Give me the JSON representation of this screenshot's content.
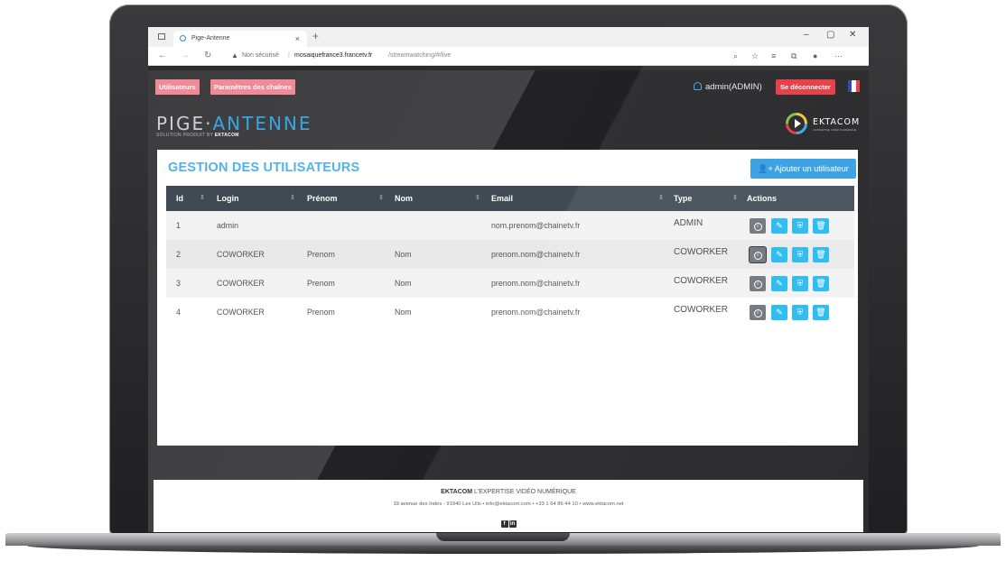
{
  "browser": {
    "tab_title": "Pige-Antenne",
    "tab_close": "×",
    "new_tab": "+",
    "security_label": "Non sécurisé",
    "url_host": "mosaiquefrance3.francetv.fr",
    "url_path": "/streamwatching/#/live",
    "window_controls": [
      "–",
      "▢",
      "✕"
    ]
  },
  "header": {
    "nav_users": "Utilisateurs",
    "nav_channels": "Paramètres des chaînes",
    "user_label": "admin(ADMIN)",
    "logout_label": "Se déconnecter",
    "flag_colors": [
      "#1f3fa8",
      "#ffffff",
      "#e3343f"
    ],
    "logo_part1": "PIGE·",
    "logo_part2": "ANTENNE",
    "logo_subtitle": "SOLUTION PRODUIT BY",
    "logo_subtitle_brand": "EKTACOM",
    "partner_name": "EKTACOM",
    "partner_tagline": "L'EXPERTISE VIDÉO NUMÉRIQUE"
  },
  "panel": {
    "title": "GESTION DES UTILISATEURS",
    "add_button": "Ajouter un utilisateur",
    "columns": [
      "Id",
      "Login",
      "Prénom",
      "Nom",
      "Email",
      "Type",
      "Actions"
    ],
    "rows": [
      {
        "id": "1",
        "login": "admin",
        "prenom": "",
        "nom": "",
        "email": "nom.prenom@chainetv.fr",
        "type": "ADMIN"
      },
      {
        "id": "2",
        "login": "COWORKER",
        "prenom": "Prenom",
        "nom": "Nom",
        "email": "prenom.nom@chainetv.fr",
        "type": "COWORKER"
      },
      {
        "id": "3",
        "login": "COWORKER",
        "prenom": "Prenom",
        "nom": "Nom",
        "email": "prenom.nom@chainetv.fr",
        "type": "COWORKER"
      },
      {
        "id": "4",
        "login": "COWORKER",
        "prenom": "Prenom",
        "nom": "Nom",
        "email": "prenom.nom@chainetv.fr",
        "type": "COWORKER"
      }
    ],
    "action_icons": [
      "info-icon",
      "pencil-icon",
      "shield-icon",
      "trash-icon"
    ],
    "accent_color": "#52b3e6",
    "header_color": "#3f4a55"
  },
  "footer": {
    "brand": "EKTACOM",
    "tagline": "L'EXPERTISE VIDÉO NUMÉRIQUE",
    "address": "19 avenue des Indes - 91940 Les Ulis • info@ektacom.com • +33 1 64 86 44 10 • www.ektacom.net",
    "social_icons": [
      "facebook-icon",
      "linkedin-icon"
    ]
  }
}
